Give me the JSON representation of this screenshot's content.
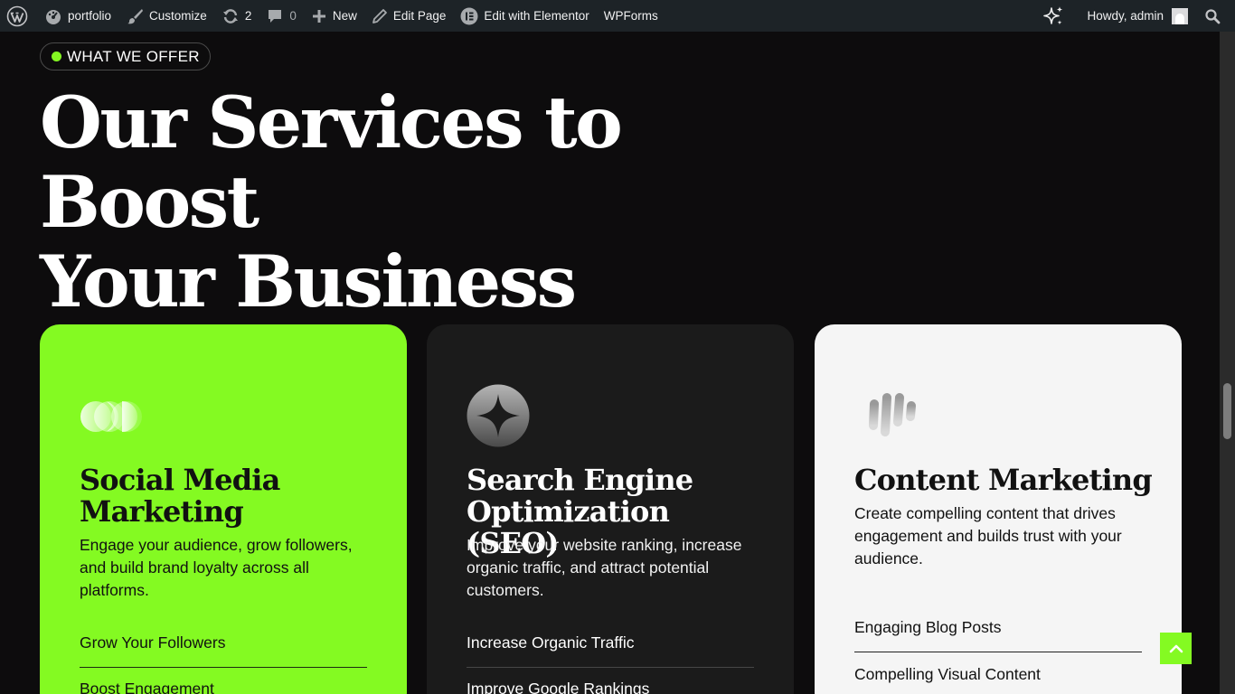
{
  "admin_bar": {
    "site_name": "portfolio",
    "customize": "Customize",
    "updates_count": "2",
    "comments_count": "0",
    "new_label": "New",
    "edit_page": "Edit Page",
    "elementor": "Edit with Elementor",
    "wpforms": "WPForms",
    "howdy": "Howdy, admin"
  },
  "section": {
    "tag": "WHAT WE OFFER",
    "title_line1": "Our Services to Boost",
    "title_line2": "Your Business"
  },
  "cards": [
    {
      "icon": "three-circles-icon",
      "title": "Social Media Marketing",
      "description": "Engage your audience, grow followers, and build brand loyalty across all platforms.",
      "features": [
        "Grow Your Followers",
        "Boost Engagement"
      ]
    },
    {
      "icon": "sparkle-star-icon",
      "title": "Search Engine Optimization (SEO)",
      "description": "Improve your website ranking, increase organic traffic, and attract potential customers.",
      "features": [
        "Increase Organic Traffic",
        "Improve Google Rankings"
      ]
    },
    {
      "icon": "bars-wave-icon",
      "title": "Content Marketing",
      "description": "Create compelling content that drives engagement and builds trust with your audience.",
      "features": [
        "Engaging Blog Posts",
        "Compelling Visual Content"
      ]
    }
  ],
  "colors": {
    "accent": "#84fa22",
    "background": "#0d0c0d",
    "admin_bar": "#1d2327",
    "card_dark": "#1b1b1b",
    "card_light": "#f5f5f5"
  }
}
